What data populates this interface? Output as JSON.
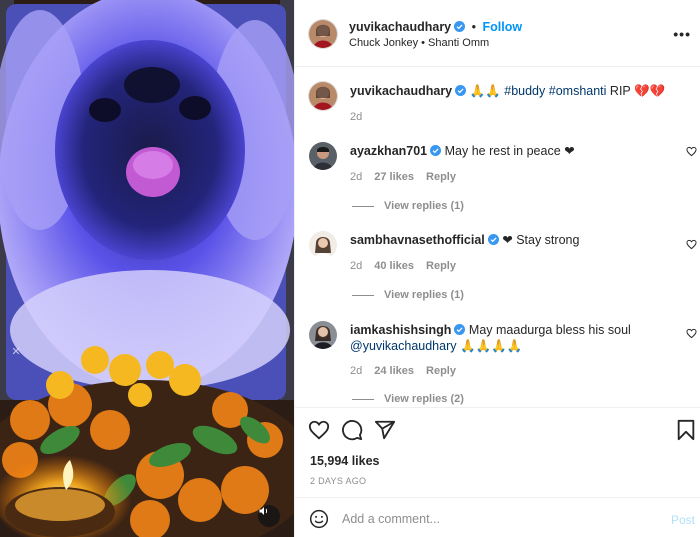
{
  "post": {
    "username": "yuvikachaudhary",
    "follow_label": "Follow",
    "separator": "•",
    "audio": "Chuck Jonkey • Shanti Omm",
    "more_label": "•••"
  },
  "caption": {
    "username": "yuvikachaudhary",
    "emoji_prefix": "🙏🙏",
    "tag1": "#buddy",
    "tag2": "#omshanti",
    "rip": "RIP 💔💔",
    "time": "2d"
  },
  "comments": [
    {
      "username": "ayazkhan701",
      "text": "May he rest in peace ❤",
      "time": "2d",
      "likes": "27 likes",
      "reply": "Reply",
      "view_replies": "View replies (1)"
    },
    {
      "username": "sambhavnasethofficial",
      "text": "❤ Stay strong",
      "time": "2d",
      "likes": "40 likes",
      "reply": "Reply",
      "view_replies": "View replies (1)"
    },
    {
      "username": "iamkashishsingh",
      "text": "May maadurga bless his soul",
      "mention": "@yuvikachaudhary 🙏🙏🙏🙏",
      "time": "2d",
      "likes": "24 likes",
      "reply": "Reply",
      "view_replies": "View replies (2)"
    }
  ],
  "actions": {
    "likes": "15,994 likes",
    "date": "2 DAYS AGO"
  },
  "add_comment": {
    "placeholder": "Add a comment...",
    "post_label": "Post"
  },
  "colors": {
    "accent": "#0095f6",
    "verified": "#3897f0",
    "muted": "#8e8e8e",
    "text": "#262626"
  },
  "icons": [
    "verified-badge-icon",
    "heart-icon",
    "comment-icon",
    "share-icon",
    "bookmark-icon",
    "emoji-icon",
    "sound-icon",
    "more-icon"
  ]
}
